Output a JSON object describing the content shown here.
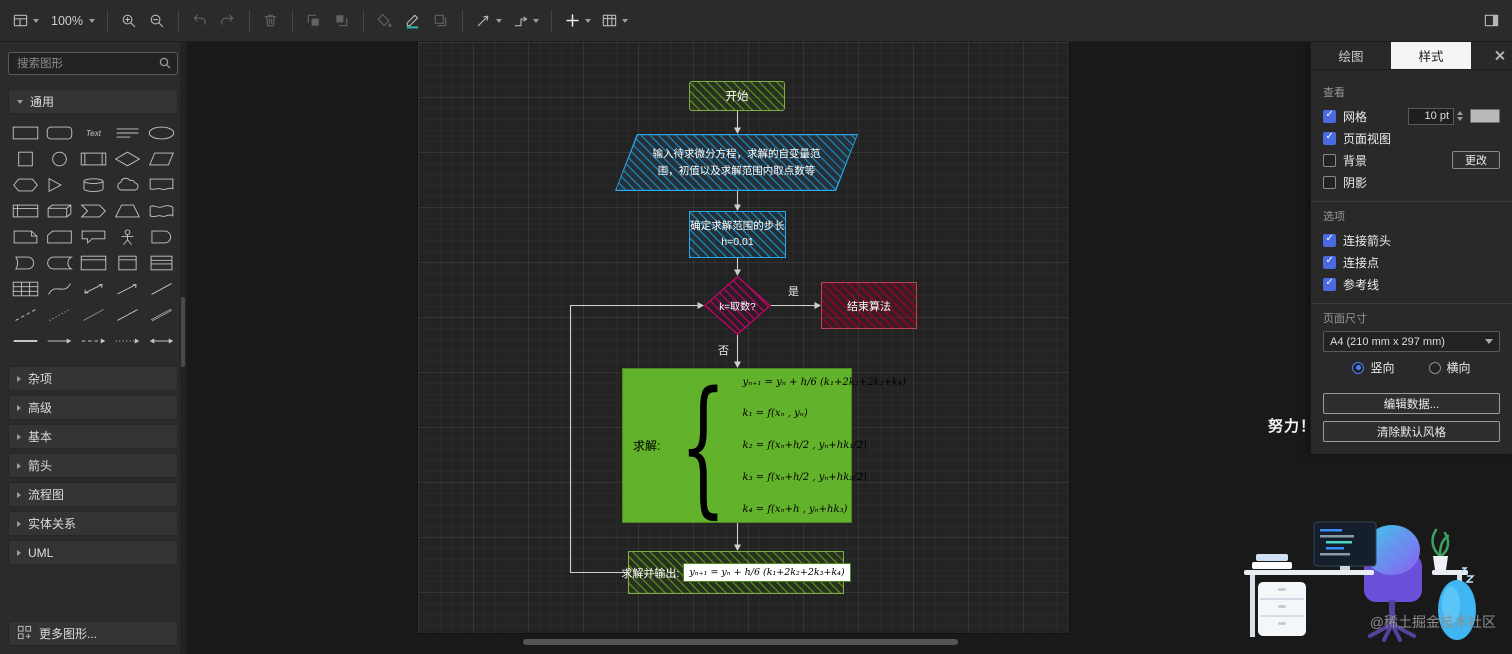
{
  "toolbar": {
    "zoom_label": "100%",
    "items": [
      {
        "icon": "pages",
        "caret": true
      },
      {
        "icon": "zoom-level",
        "caret": true
      },
      {
        "divider": true
      },
      {
        "icon": "zoom-in"
      },
      {
        "icon": "zoom-out"
      },
      {
        "divider": true
      },
      {
        "icon": "undo",
        "dim": true
      },
      {
        "icon": "redo",
        "dim": true
      },
      {
        "divider": true
      },
      {
        "icon": "delete",
        "dim": true
      },
      {
        "divider": true
      },
      {
        "icon": "to-front",
        "dim": true
      },
      {
        "icon": "to-back",
        "dim": true
      },
      {
        "divider": true
      },
      {
        "icon": "fill-color",
        "dim": true
      },
      {
        "icon": "line-color"
      },
      {
        "icon": "shadow",
        "dim": true
      },
      {
        "divider": true
      },
      {
        "icon": "connection",
        "caret": true
      },
      {
        "icon": "waypoints",
        "caret": true
      },
      {
        "divider": true
      },
      {
        "icon": "insert",
        "caret": true
      },
      {
        "icon": "table",
        "caret": true
      }
    ]
  },
  "sidebar": {
    "search_placeholder": "搜索图形",
    "sections": [
      {
        "label": "通用",
        "expanded": true
      },
      {
        "label": "杂项"
      },
      {
        "label": "高级"
      },
      {
        "label": "基本"
      },
      {
        "label": "箭头"
      },
      {
        "label": "流程图"
      },
      {
        "label": "实体关系"
      },
      {
        "label": "UML"
      }
    ],
    "more_shapes_label": "更多图形...",
    "palette_shapes": [
      "rectangle",
      "rounded-rectangle",
      "text",
      "heading",
      "ellipse",
      "square",
      "circle",
      "process",
      "diamond",
      "parallelogram",
      "hexagon",
      "triangle",
      "cylinder",
      "cloud",
      "document",
      "internal-storage",
      "cube",
      "step",
      "trapezoid",
      "tape",
      "note",
      "card",
      "callout",
      "actor",
      "or",
      "and",
      "data-storage",
      "container",
      "vertical-container",
      "list",
      "table",
      "curve",
      "bidirectional-arrow",
      "diagonal-arrow",
      "diagonal-line",
      "dashed-line",
      "dotted-line",
      "thin-line",
      "line",
      "link",
      "horizontal-line",
      "horizontal-arrow",
      "dashed-horizontal-arrow",
      "dotted-horizontal-arrow",
      "bidirectional-horizontal-arrow"
    ]
  },
  "canvas": {
    "flowchart": {
      "start": "开始",
      "input": "输入待求微分方程，求解的自变量范围，初值以及求解范围内取点数等",
      "step_text": "确定求解范围的步长",
      "step_value": "h=0.01",
      "decision": "k=取数?",
      "yes_label": "是",
      "no_label": "否",
      "end": "结束算法",
      "solve_label": "求解:",
      "brace": "{",
      "equations": [
        "yₙ₊₁ = yₙ + h/6 (k₁+2k₂+2k₃+k₄)",
        "k₁ = f(xₙ , yₙ)",
        "k₂ = f(xₙ+h/2 , yₙ+hk₁/2)",
        "k₃ = f(xₙ+h/2 , yₙ+hk₂/2)",
        "k₄ = f(xₙ+h , yₙ+hk₃)"
      ],
      "output_label": "求解并输出:",
      "output_formula": "yₙ₊₁ = yₙ + h/6 (k₁+2k₂+2k₃+k₄)"
    }
  },
  "format_panel": {
    "tabs": [
      {
        "label": "绘图"
      },
      {
        "label": "样式",
        "active": true
      }
    ],
    "view_section": "查看",
    "grid_label": "网格",
    "grid_checked": true,
    "grid_size": "10 pt",
    "page_view_label": "页面视图",
    "page_view_checked": true,
    "background_label": "背景",
    "background_checked": false,
    "change_button": "更改",
    "shadow_label": "阴影",
    "shadow_checked": false,
    "options_section": "选项",
    "connection_arrows_label": "连接箭头",
    "connection_arrows_checked": true,
    "connection_points_label": "连接点",
    "connection_points_checked": true,
    "guides_label": "参考线",
    "guides_checked": true,
    "page_size_section": "页面尺寸",
    "page_size_value": "A4 (210 mm x 297 mm)",
    "portrait_label": "竖向",
    "portrait_selected": true,
    "landscape_label": "横向",
    "landscape_selected": false,
    "edit_data_button": "编辑数据...",
    "clear_default_style_button": "清除默认风格"
  },
  "decor": {
    "slogan": "努力！奋斗！",
    "watermark": "@稀土掘金技术社区"
  },
  "colors": {
    "green": "#60a917",
    "blue": "#1ba1e2",
    "magenta": "#d80073",
    "red": "#a20025",
    "solid_green": "#63b22b",
    "checkbox_blue": "#4a6bdf",
    "toolbar_bg": "#2b2b2b",
    "canvas_bg": "#232323"
  }
}
